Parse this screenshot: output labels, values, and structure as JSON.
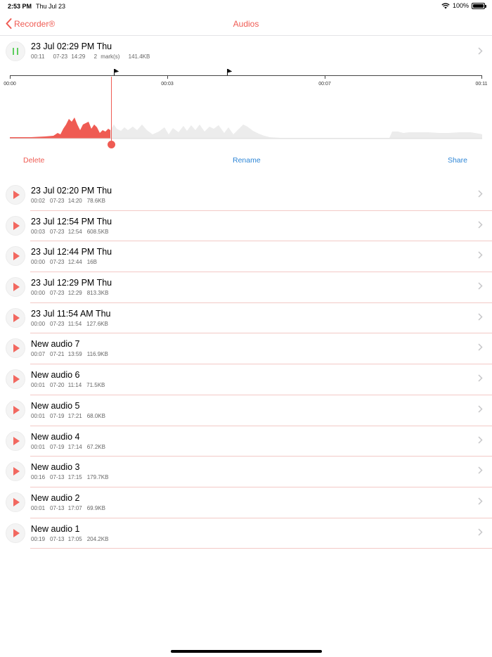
{
  "status_bar": {
    "time": "2:53 PM",
    "date": "Thu Jul 23",
    "battery": "100%"
  },
  "nav": {
    "back_label": "Recorder®",
    "title": "Audios"
  },
  "current": {
    "title": "23 Jul 02:29 PM Thu",
    "duration": "00:11",
    "datetime": "07-23 14:29",
    "marks": "2 mark(s)",
    "size": "141.4KB",
    "timeline_labels": [
      "00:00",
      "00:03",
      "00:07",
      "00:11"
    ],
    "playback_position": 0.214,
    "mark_positions": [
      0.22,
      0.46
    ]
  },
  "actions": {
    "delete": "Delete",
    "rename": "Rename",
    "share": "Share"
  },
  "recordings": [
    {
      "title": "23 Jul 02:20 PM Thu",
      "duration": "00:02",
      "datetime": "07-23 14:20",
      "size": "78.6KB"
    },
    {
      "title": "23 Jul 12:54 PM Thu",
      "duration": "00:03",
      "datetime": "07-23 12:54",
      "size": "608.5KB"
    },
    {
      "title": "23 Jul 12:44 PM Thu",
      "duration": "00:00",
      "datetime": "07-23 12:44",
      "size": "16B"
    },
    {
      "title": "23 Jul 12:29 PM Thu",
      "duration": "00:00",
      "datetime": "07-23 12:29",
      "size": "813.3KB"
    },
    {
      "title": "23 Jul 11:54 AM Thu",
      "duration": "00:00",
      "datetime": "07-23 11:54",
      "size": "127.6KB"
    },
    {
      "title": "New audio 7",
      "duration": "00:07",
      "datetime": "07-21 13:59",
      "size": "116.9KB"
    },
    {
      "title": "New audio 6",
      "duration": "00:01",
      "datetime": "07-20 11:14",
      "size": "71.5KB"
    },
    {
      "title": "New audio 5",
      "duration": "00:01",
      "datetime": "07-19 17:21",
      "size": "68.0KB"
    },
    {
      "title": "New audio 4",
      "duration": "00:01",
      "datetime": "07-19 17:14",
      "size": "67.2KB"
    },
    {
      "title": "New audio 3",
      "duration": "00:16",
      "datetime": "07-13 17:15",
      "size": "179.7KB"
    },
    {
      "title": "New audio 2",
      "duration": "00:01",
      "datetime": "07-13 17:07",
      "size": "69.9KB"
    },
    {
      "title": "New audio 1",
      "duration": "00:19",
      "datetime": "07-13 17:05",
      "size": "204.2KB"
    }
  ],
  "colors": {
    "accent": "#ef5b53",
    "link": "#2e86d6",
    "play": "#f26860",
    "pause": "#5fce5f",
    "separator": "#f3c9c6"
  },
  "icons": {
    "back": "chevron-left-icon",
    "row_play": "play-icon",
    "current_pause": "pause-icon",
    "disclosure": "chevron-right-icon",
    "marker": "flag-icon"
  }
}
